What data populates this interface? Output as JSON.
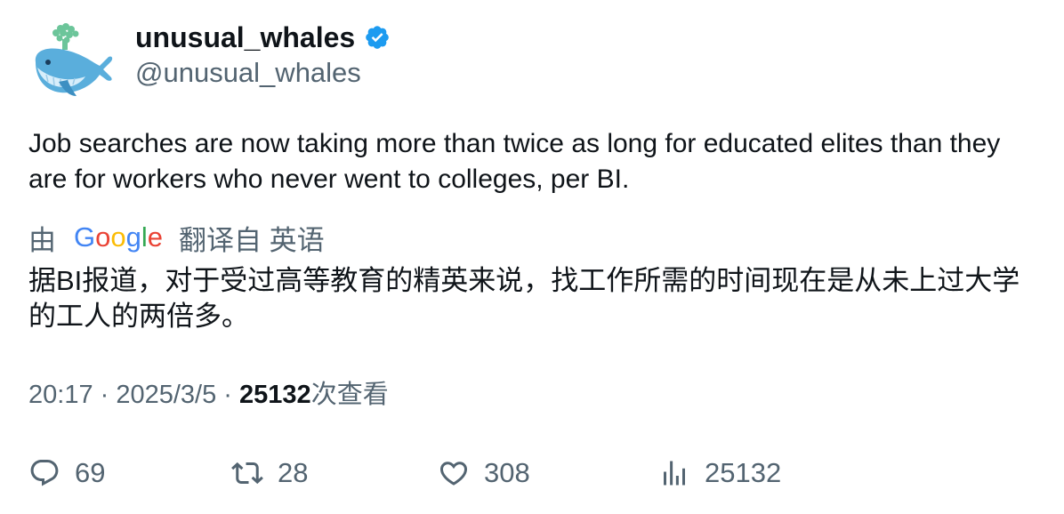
{
  "author": {
    "display_name": "unusual_whales",
    "handle": "@unusual_whales",
    "verified": true,
    "avatar_icon": "whale-icon"
  },
  "tweet": {
    "text": "Job searches are now taking more than twice as long for educated elites than they are for workers who never went to colleges, per BI."
  },
  "translation": {
    "prefix": "由",
    "provider": "Google",
    "suffix": "翻译自 英语",
    "text": "据BI报道，对于受过高等教育的精英来说，找工作所需的时间现在是从未上过大学的工人的两倍多。"
  },
  "meta": {
    "time": "20:17",
    "separator": " · ",
    "date": "2025/3/5",
    "views_count": "25132",
    "views_label": "次查看"
  },
  "actions": {
    "reply": {
      "icon": "reply-icon",
      "count": "69"
    },
    "retweet": {
      "icon": "retweet-icon",
      "count": "28"
    },
    "like": {
      "icon": "heart-icon",
      "count": "308"
    },
    "views": {
      "icon": "analytics-icon",
      "count": "25132"
    }
  },
  "colors": {
    "text_primary": "#0f1419",
    "text_secondary": "#536471",
    "verified_blue": "#1d9bf0",
    "google_blue": "#4285F4",
    "google_red": "#EA4335",
    "google_yellow": "#FBBC05",
    "google_green": "#34A853"
  }
}
